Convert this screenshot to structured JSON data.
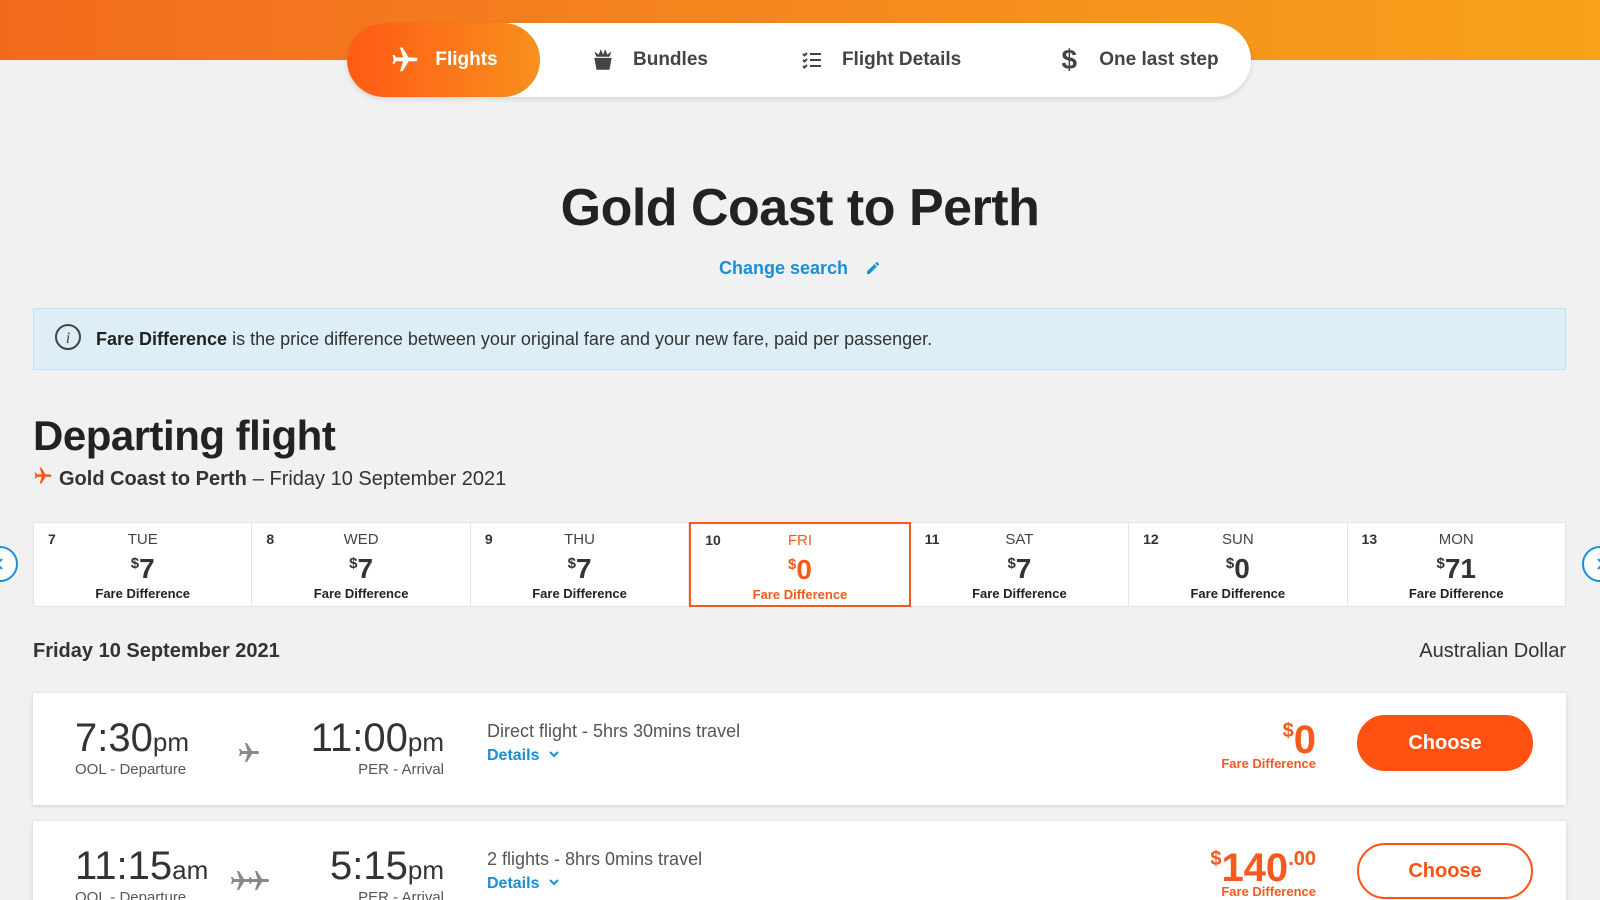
{
  "stepper": {
    "steps": [
      {
        "label": "Flights",
        "icon": "plane-icon"
      },
      {
        "label": "Bundles",
        "icon": "bundle-icon"
      },
      {
        "label": "Flight Details",
        "icon": "checklist-icon"
      },
      {
        "label": "One last step",
        "icon": "dollar-icon"
      }
    ]
  },
  "header": {
    "title": "Gold Coast to Perth",
    "change_search": "Change search"
  },
  "info_banner": {
    "bold": "Fare Difference",
    "text": " is the price difference between your original fare and your new fare, paid per passenger."
  },
  "departing": {
    "title": "Departing flight",
    "route_bold": "Gold Coast to Perth",
    "route_date": "– Friday 10 September 2021"
  },
  "date_strip": [
    {
      "num": "7",
      "day": "TUE",
      "currency": "$",
      "price": "7",
      "label": "Fare Difference"
    },
    {
      "num": "8",
      "day": "WED",
      "currency": "$",
      "price": "7",
      "label": "Fare Difference"
    },
    {
      "num": "9",
      "day": "THU",
      "currency": "$",
      "price": "7",
      "label": "Fare Difference"
    },
    {
      "num": "10",
      "day": "FRI",
      "currency": "$",
      "price": "0",
      "label": "Fare Difference"
    },
    {
      "num": "11",
      "day": "SAT",
      "currency": "$",
      "price": "7",
      "label": "Fare Difference"
    },
    {
      "num": "12",
      "day": "SUN",
      "currency": "$",
      "price": "0",
      "label": "Fare Difference"
    },
    {
      "num": "13",
      "day": "MON",
      "currency": "$",
      "price": "71",
      "label": "Fare Difference"
    }
  ],
  "results": {
    "day_heading": "Friday 10 September 2021",
    "currency": "Australian Dollar",
    "flights": [
      {
        "dep_time": "7:30",
        "dep_ampm": "pm",
        "dep_label": "OOL - Departure",
        "arr_time": "11:00",
        "arr_ampm": "pm",
        "arr_label": "PER - Arrival",
        "description": "Direct flight - 5hrs 30mins travel",
        "details": "Details",
        "currency": "$",
        "price": "0",
        "cents": "",
        "price_label": "Fare Difference",
        "choose": "Choose"
      },
      {
        "dep_time": "11:15",
        "dep_ampm": "am",
        "dep_label": "OOL - Departure",
        "arr_time": "5:15",
        "arr_ampm": "pm",
        "arr_label": "PER - Arrival",
        "description": "2 flights - 8hrs 0mins travel",
        "details": "Details",
        "currency": "$",
        "price": "140",
        "cents": ".00",
        "price_label": "Fare Difference",
        "choose": "Choose"
      }
    ]
  },
  "colors": {
    "brand_orange": "#ff5212",
    "link_blue": "#1a8fd6",
    "info_bg": "#ddeef7"
  }
}
